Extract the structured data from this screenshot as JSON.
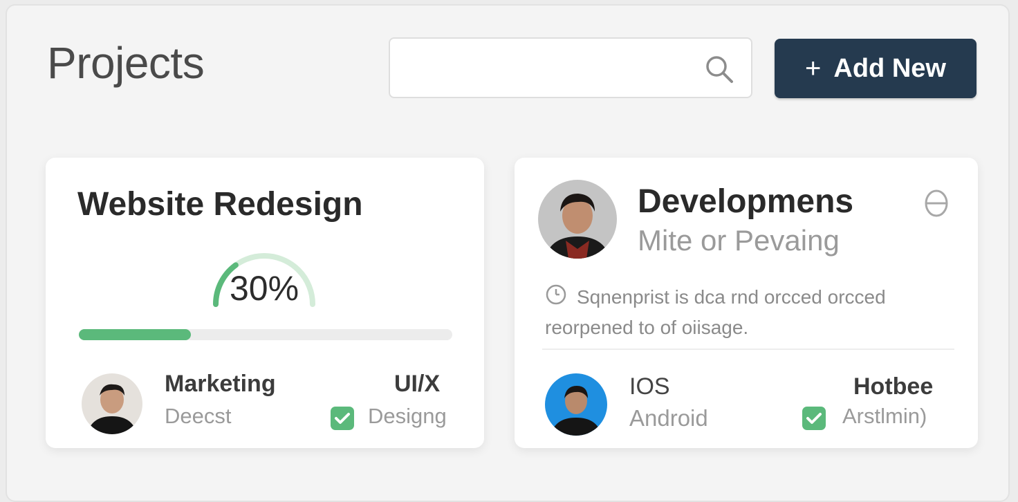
{
  "header": {
    "title": "Projects",
    "search": {
      "value": "",
      "placeholder": ""
    },
    "add_button": {
      "icon": "+",
      "label": "Add New"
    }
  },
  "cards": [
    {
      "title": "Website Redesign",
      "progress": {
        "percent": 30,
        "label": "30%"
      },
      "colors": {
        "progress": "#5bb97b"
      },
      "footer": {
        "left_title": "Marketing",
        "left_sub": "Deecst",
        "right_title": "UI/X",
        "right_sub": "Designg"
      }
    },
    {
      "title": "Developmens",
      "subtitle": "Mite or Pevaing",
      "description": "Sqnenprist is dca rnd orcced orcced reorpened to of oiisage.",
      "footer": {
        "left_title": "IOS",
        "left_sub": "Android",
        "right_title": "Hotbee",
        "right_sub": "Arstlmin)"
      }
    }
  ],
  "colors": {
    "accent_button": "#253a4f",
    "success": "#5bb97b",
    "avatar_blue": "#1f8fe0"
  },
  "icons": [
    "search-icon",
    "plus-icon",
    "check-icon",
    "collapse-icon",
    "clock-icon"
  ]
}
